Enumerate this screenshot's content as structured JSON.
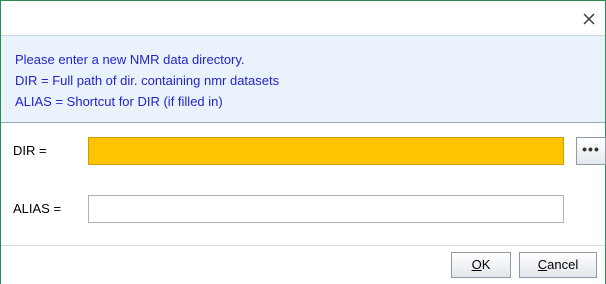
{
  "dialog": {
    "close_icon": "close-icon",
    "info": {
      "line1": "Please enter a new NMR data directory.",
      "line2": " DIR = Full path of dir. containing nmr datasets",
      "line3": " ALIAS = Shortcut for DIR (if filled in)"
    },
    "form": {
      "dir_label": "DIR =",
      "dir_value": "",
      "alias_label": "ALIAS =",
      "alias_value": "",
      "browse_label": "•••",
      "browse_icon": "ellipsis-icon"
    },
    "buttons": {
      "ok_mnemonic": "O",
      "ok_rest": "K",
      "cancel_mnemonic": "C",
      "cancel_rest": "ancel"
    }
  },
  "colors": {
    "info_text": "#2424c8",
    "info_bg": "#eaf2fb",
    "dir_field_bg": "#ffc400",
    "border_accent": "#2e8b57"
  }
}
